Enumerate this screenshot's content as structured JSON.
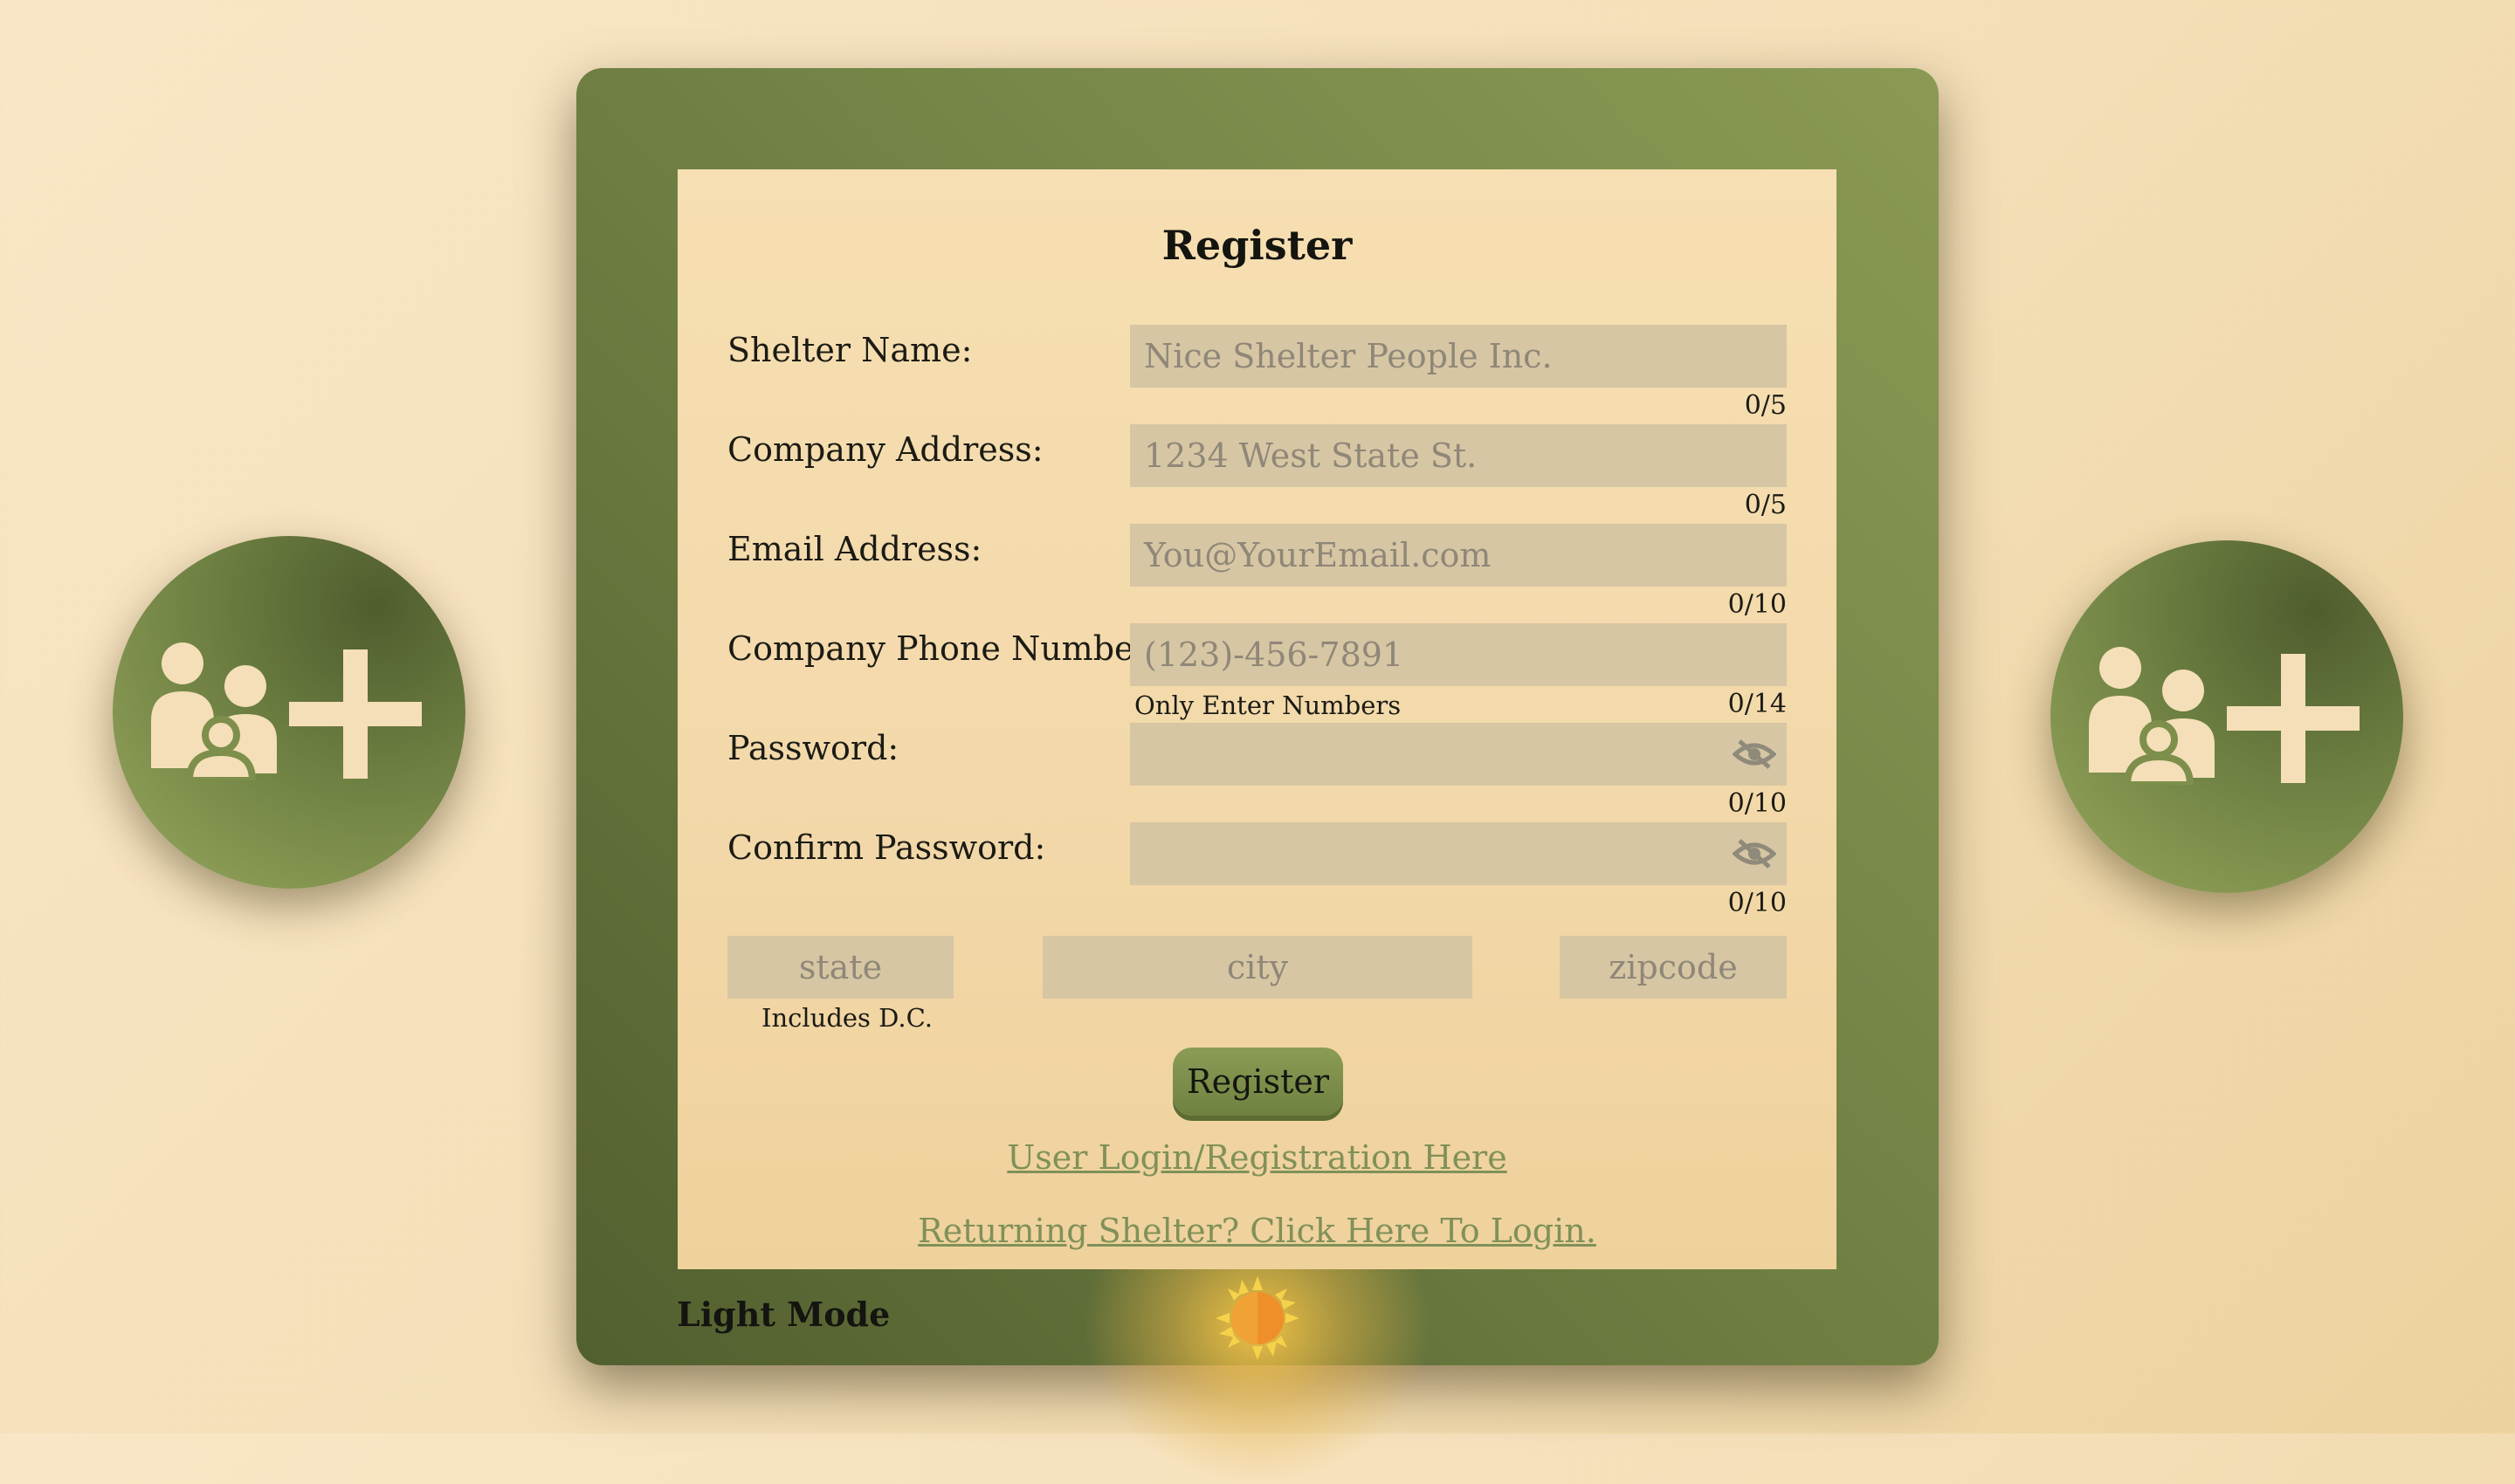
{
  "form": {
    "title": "Register",
    "fields": [
      {
        "label": "Shelter Name:",
        "placeholder": "Nice Shelter People Inc.",
        "counter": "0/5"
      },
      {
        "label": "Company Address:",
        "placeholder": "1234 West State St.",
        "counter": "0/5"
      },
      {
        "label": "Email Address:",
        "placeholder": "You@YourEmail.com",
        "counter": "0/10"
      },
      {
        "label": "Company Phone Number:",
        "placeholder": "(123)-456-7891",
        "counter": "0/14",
        "hint": "Only Enter Numbers"
      },
      {
        "label": "Password:",
        "placeholder": "",
        "counter": "0/10",
        "icon": "eye-slash-icon"
      },
      {
        "label": "Confirm Password:",
        "placeholder": "",
        "counter": "0/10",
        "icon": "eye-slash-icon"
      }
    ],
    "location": {
      "state_placeholder": "state",
      "state_hint": "Includes D.C.",
      "city_placeholder": "city",
      "zip_placeholder": "zipcode"
    },
    "submit_label": "Register",
    "user_link": "User Login/Registration Here",
    "returning_link": "Returning Shelter? Click Here To Login."
  },
  "footer": {
    "mode_label": "Light Mode",
    "mode_icon": "sun-icon"
  },
  "decor": {
    "badge_icon": "add-family-icon",
    "accent_green": "#6e8042",
    "cream": "#f4dfb8"
  }
}
